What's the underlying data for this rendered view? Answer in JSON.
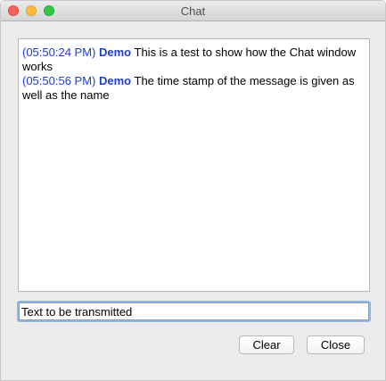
{
  "window": {
    "title": "Chat"
  },
  "chat": {
    "messages": [
      {
        "timestamp": "(05:50:24 PM)",
        "sender": "Demo",
        "text": "This is a test to show how the Chat window works"
      },
      {
        "timestamp": "(05:50:56 PM)",
        "sender": "Demo",
        "text": "The time stamp of the message is given as well as the name"
      }
    ]
  },
  "input": {
    "value": "Text to be transmitted"
  },
  "buttons": {
    "clear_label": "Clear",
    "close_label": "Close"
  },
  "colors": {
    "timestamp": "#1f3bd6",
    "sender": "#1f3bd6",
    "focus_ring": "#8db8ee",
    "close_light": "#fc605c",
    "minimize_light": "#fdbc40",
    "zoom_light": "#34c84a"
  }
}
